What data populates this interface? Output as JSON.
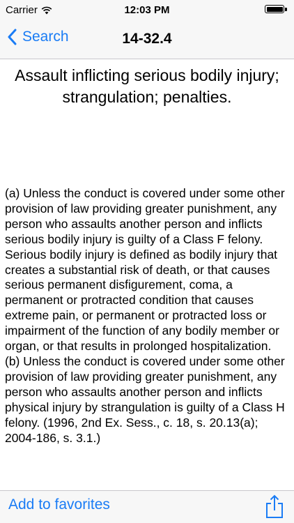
{
  "status_bar": {
    "carrier": "Carrier",
    "time": "12:03 PM",
    "battery_level": 1.0
  },
  "nav_bar": {
    "back_label": "Search",
    "title": "14-32.4"
  },
  "content": {
    "heading": "Assault inflicting serious bodily injury; strangulation; penalties.",
    "paragraphs": [
      "(a)   Unless the conduct is covered under some other provision of law providing greater punishment, any person who assaults another person and inflicts serious bodily injury is guilty of a Class F felony. Serious bodily injury is defined as bodily injury that creates a substantial risk of death, or that causes serious permanent disfigurement, coma, a permanent or protracted condition that causes extreme pain, or permanent or protracted loss or impairment of the function of any bodily member or organ, or that results in prolonged hospitalization.",
      "(b)   Unless the conduct is covered under some other provision of law providing greater punishment, any person who assaults another person and inflicts physical injury by strangulation is guilty of a Class H felony. (1996, 2nd Ex. Sess., c. 18, s. 20.13(a); 2004-186, s. 3.1.)"
    ]
  },
  "toolbar": {
    "favorites_label": "Add to favorites",
    "share_icon": "share-icon"
  },
  "colors": {
    "accent": "#1a7cf5",
    "bar_background": "#f7f7f7"
  }
}
